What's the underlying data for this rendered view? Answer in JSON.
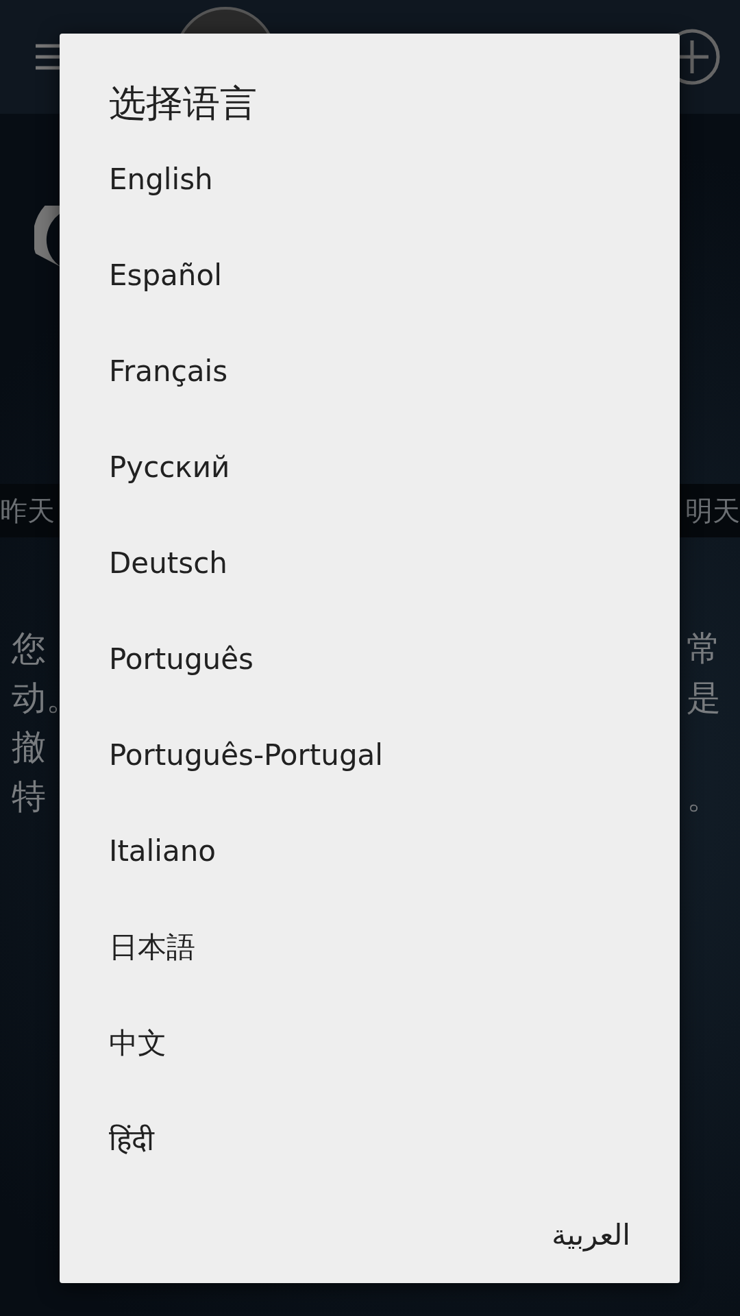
{
  "background": {
    "day_bar": {
      "previous": "昨天",
      "next": "明天"
    },
    "text_fragments": {
      "left": [
        "您",
        "动。",
        "撤",
        "特"
      ],
      "right": [
        "常",
        "是",
        "。"
      ]
    }
  },
  "dialog": {
    "title": "选择语言",
    "options": [
      {
        "label": "English",
        "rtl": false
      },
      {
        "label": "Español",
        "rtl": false
      },
      {
        "label": "Français",
        "rtl": false
      },
      {
        "label": "Русский",
        "rtl": false
      },
      {
        "label": "Deutsch",
        "rtl": false
      },
      {
        "label": "Português",
        "rtl": false
      },
      {
        "label": "Português-Portugal",
        "rtl": false
      },
      {
        "label": "Italiano",
        "rtl": false
      },
      {
        "label": "日本語",
        "rtl": false
      },
      {
        "label": "中文",
        "rtl": false
      },
      {
        "label": "हिंदी",
        "rtl": false
      },
      {
        "label": "العربية",
        "rtl": true
      }
    ]
  }
}
